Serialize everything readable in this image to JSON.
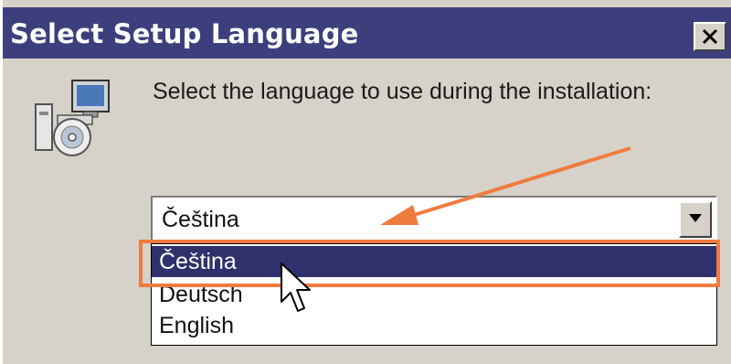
{
  "window": {
    "title": "Select Setup Language",
    "close_icon": "close-icon"
  },
  "dialog": {
    "icon": "setup-computer-cd-icon",
    "prompt": "Select the language to use during the installation:"
  },
  "language_select": {
    "selected_value": "Čeština",
    "dropdown_icon": "chevron-down-icon",
    "options": [
      "Čeština",
      "Deutsch",
      "English"
    ],
    "highlighted_option_index": 0
  },
  "annotation": {
    "color": "#f07b3f"
  },
  "colors": {
    "titlebar": "#3d3f7d",
    "selection": "#2e316b",
    "dialog_bg": "#d6d2c9"
  }
}
